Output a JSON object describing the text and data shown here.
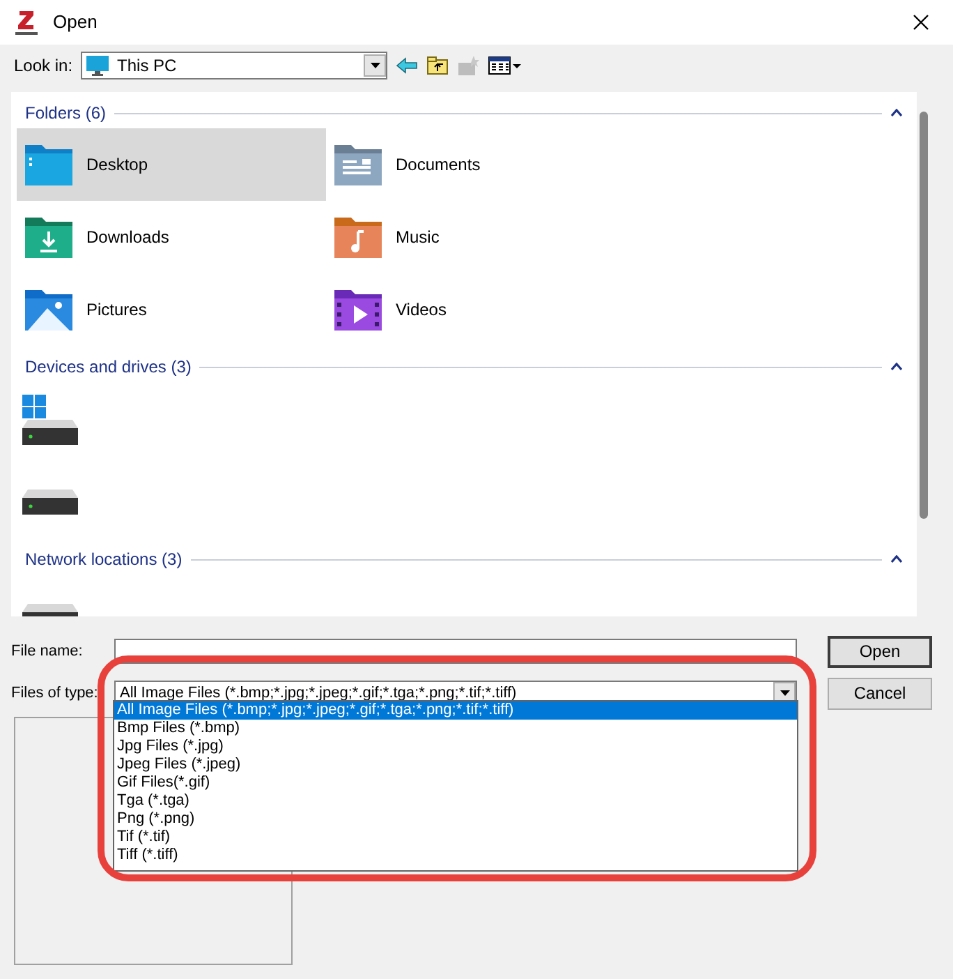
{
  "window": {
    "title": "Open"
  },
  "look_in": {
    "label": "Look in:",
    "value": "This PC"
  },
  "groups": [
    {
      "title": "Folders (6)",
      "expanded": true,
      "items": [
        {
          "name": "Desktop",
          "kind": "desktop",
          "selected": true
        },
        {
          "name": "Documents",
          "kind": "documents",
          "selected": false
        },
        {
          "name": "Downloads",
          "kind": "downloads",
          "selected": false
        },
        {
          "name": "Music",
          "kind": "music",
          "selected": false
        },
        {
          "name": "Pictures",
          "kind": "pictures",
          "selected": false
        },
        {
          "name": "Videos",
          "kind": "videos",
          "selected": false
        }
      ]
    },
    {
      "title": "Devices and drives (3)",
      "expanded": true,
      "items": [
        {
          "kind": "system-drive",
          "selected": false
        },
        {
          "kind": "drive",
          "selected": false
        }
      ]
    },
    {
      "title": "Network locations (3)",
      "expanded": true,
      "items": [
        {
          "kind": "network-drive",
          "selected": false
        }
      ]
    }
  ],
  "file_name": {
    "label": "File name:"
  },
  "files_of_type": {
    "label": "Files of type:",
    "value": "All Image Files (*.bmp;*.jpg;*.jpeg;*.gif;*.tga;*.png;*.tif;*.tiff)",
    "expanded": true,
    "options": [
      {
        "label": "All Image Files (*.bmp;*.jpg;*.jpeg;*.gif;*.tga;*.png;*.tif;*.tiff)",
        "selected": true
      },
      {
        "label": "Bmp Files (*.bmp)",
        "selected": false
      },
      {
        "label": "Jpg Files (*.jpg)",
        "selected": false
      },
      {
        "label": "Jpeg Files (*.jpeg)",
        "selected": false
      },
      {
        "label": "Gif Files(*.gif)",
        "selected": false
      },
      {
        "label": "Tga (*.tga)",
        "selected": false
      },
      {
        "label": "Png (*.png)",
        "selected": false
      },
      {
        "label": "Tif (*.tif)",
        "selected": false
      },
      {
        "label": "Tiff (*.tiff)",
        "selected": false
      }
    ]
  },
  "buttons": [
    {
      "label": "Open"
    },
    {
      "label": "Cancel"
    }
  ]
}
